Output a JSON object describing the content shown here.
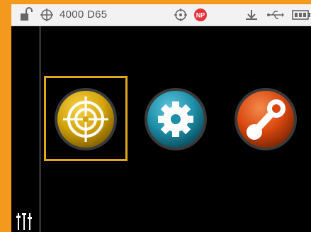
{
  "status_bar": {
    "illuminant_text": "4000 D65",
    "icons": [
      "unlock-icon",
      "crosshair-icon",
      "target-icon",
      "np-badge-icon",
      "measure-icon",
      "usb-icon",
      "battery-icon"
    ],
    "np_badge_text": "NP"
  },
  "menu": {
    "items": [
      {
        "name": "measure",
        "icon": "target-icon",
        "color": "#d4a40a",
        "selected": true
      },
      {
        "name": "settings",
        "icon": "gear-icon",
        "color": "#1d8fa8",
        "selected": false
      },
      {
        "name": "connect",
        "icon": "link-icon",
        "color": "#d9480f",
        "selected": false
      }
    ],
    "selection_color": "#e0a818"
  },
  "left_rail": {
    "icon": "sliders-icon"
  },
  "colors": {
    "bezel": "#f39a1e",
    "screen": "#000000",
    "status_bar": "#f2f2f2"
  }
}
